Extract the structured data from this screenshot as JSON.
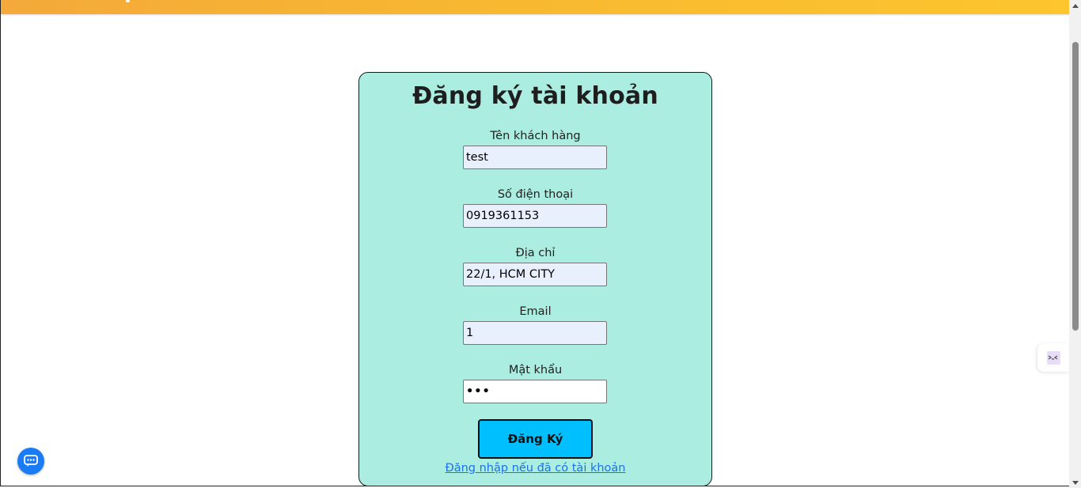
{
  "form": {
    "title": "Đăng ký tài khoản",
    "fields": [
      {
        "label": "Tên khách hàng",
        "value": "test"
      },
      {
        "label": "Số điện thoại",
        "value": "0919361153"
      },
      {
        "label": "Địa chỉ",
        "value": "22/1, HCM CITY"
      },
      {
        "label": "Email",
        "value": "1"
      },
      {
        "label": "Mật khẩu",
        "value": "•••"
      }
    ],
    "submit_label": "Đăng Ký",
    "login_link": "Đăng nhập nếu đã có tài khoản"
  },
  "colors": {
    "card_background": "#abede0",
    "submit_button": "#00bfff",
    "header_gradient_start": "#f4a93a",
    "header_gradient_end": "#fdc52e",
    "link": "#1a73e8",
    "chat_button": "#1a7cf5"
  },
  "icons": {
    "chat": "chat-bubble-icon",
    "side_widget": "code-extension-icon"
  }
}
